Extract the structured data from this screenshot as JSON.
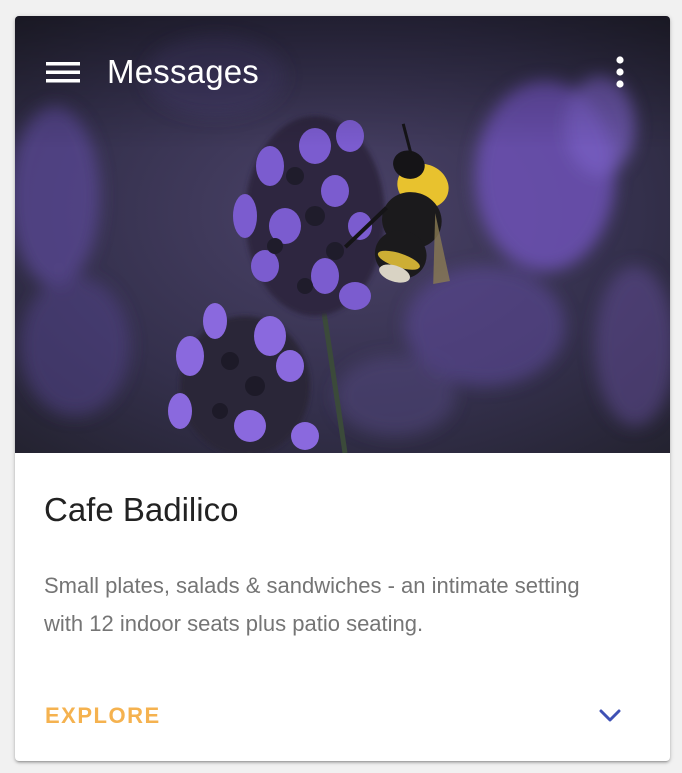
{
  "toolbar": {
    "menu_icon": "hamburger-menu-icon",
    "title": "Messages",
    "more_icon": "more-vertical-icon"
  },
  "media": {
    "description_icon": "lavender-bee-photo"
  },
  "card": {
    "title": "Cafe Badilico",
    "text": "Small plates, salads & sandwiches - an intimate setting with 12 indoor seats plus patio seating.",
    "action_label": "EXPLORE",
    "expand_icon": "chevron-down-icon"
  },
  "colors": {
    "accent": "#f5b24f",
    "expand_icon": "#3f51b5",
    "title_text": "#222222",
    "body_text": "#757575"
  }
}
